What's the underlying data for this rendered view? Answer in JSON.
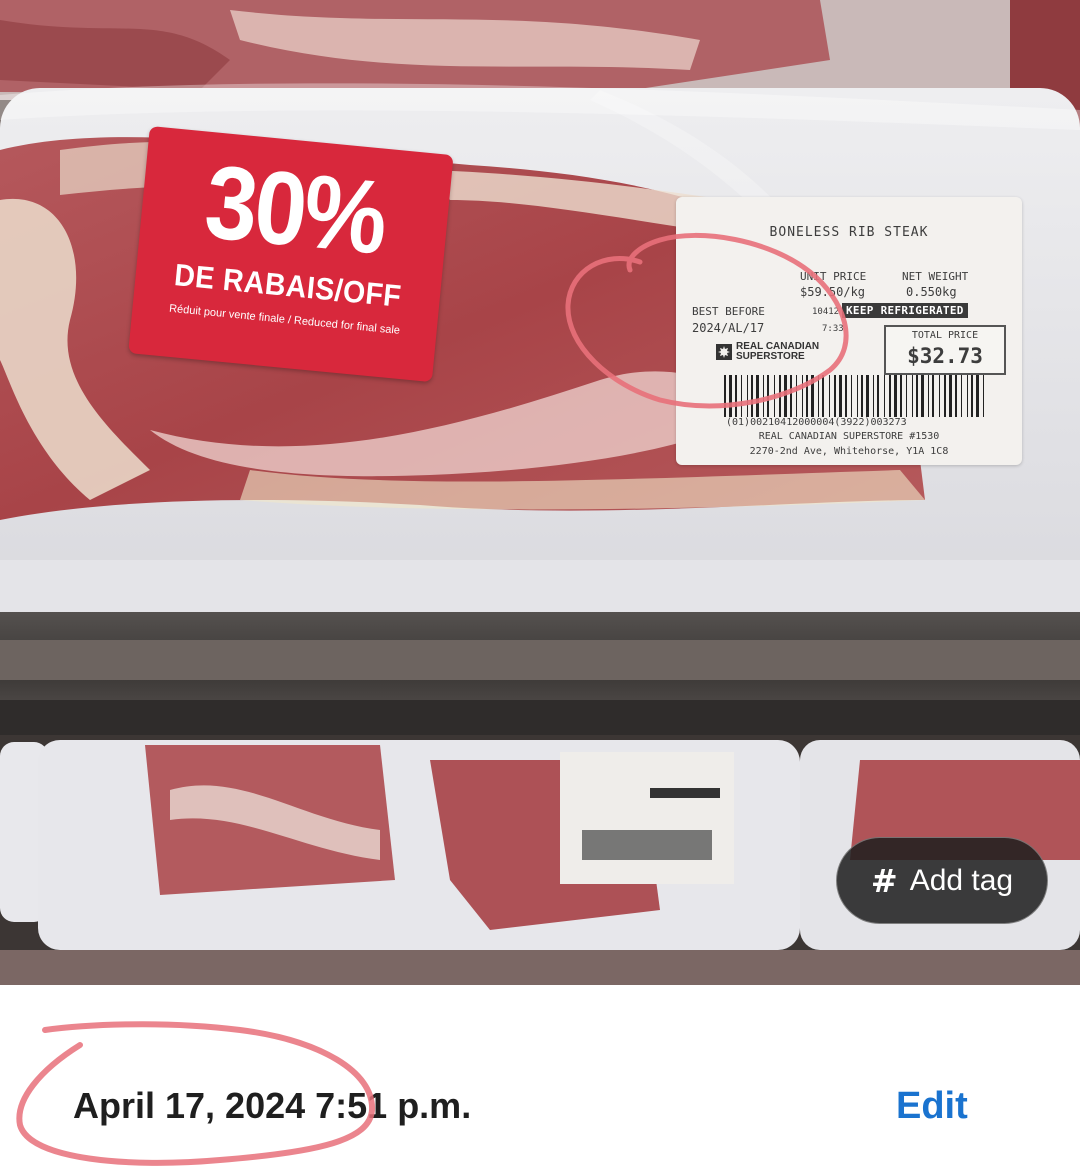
{
  "sticker": {
    "percent": "30%",
    "main_text": "DE RABAIS/OFF",
    "sub_text": "Réduit pour vente finale / Reduced for final sale"
  },
  "label": {
    "product": "BONELESS RIB STEAK",
    "unit_price_heading": "UNIT PRICE",
    "unit_price": "$59.50/kg",
    "net_weight_heading": "NET WEIGHT",
    "net_weight": "0.550kg",
    "best_before_heading": "BEST BEFORE",
    "best_before_date": "2024/AL/17",
    "lot_code": "10412",
    "pack_time": "7:33",
    "keep_refrigerated": "KEEP REFRIGERATED",
    "total_price_heading": "TOTAL PRICE",
    "total_price": "$32.73",
    "brand_line1": "REAL CANADIAN",
    "brand_line2": "SUPERSTORE",
    "barcode_number": "(01)00210412000004(3922)003273",
    "store": "REAL CANADIAN SUPERSTORE #1530",
    "address": "2270-2nd Ave, Whitehorse, Y1A 1C8"
  },
  "add_tag": {
    "icon": "hash-icon",
    "label": "Add tag"
  },
  "info": {
    "datetime": "April 17, 2024 7:51 p.m.",
    "edit_label": "Edit"
  },
  "colors": {
    "sticker_red": "#d8283c",
    "edit_blue": "#1a73cf",
    "annotation_pink": "#e8707a"
  }
}
